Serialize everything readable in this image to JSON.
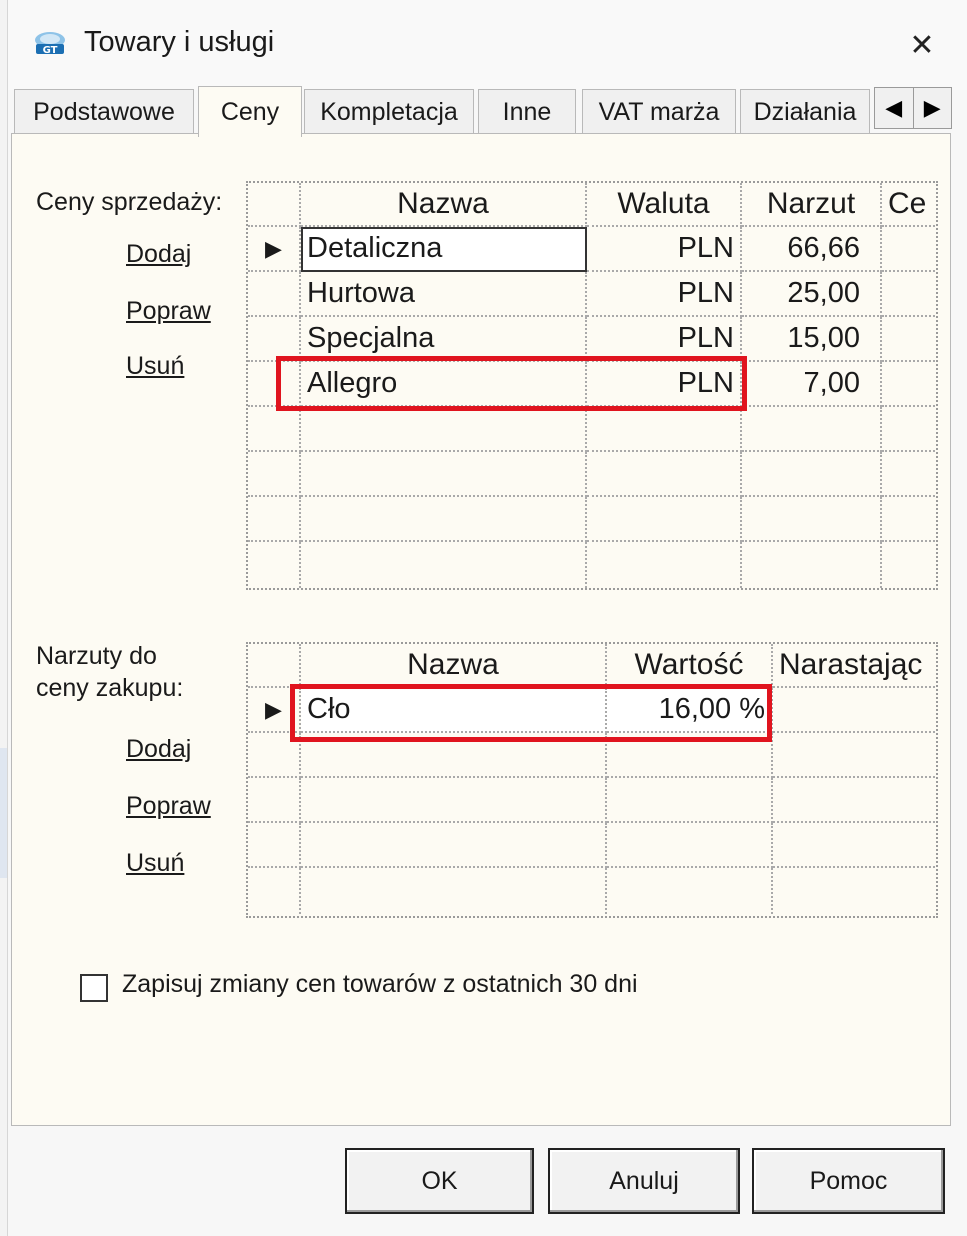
{
  "window": {
    "title": "Towary i usługi",
    "close_glyph": "✕",
    "logo_icon": "app-logo-icon"
  },
  "tabs": [
    {
      "label": "Podstawowe",
      "active": false
    },
    {
      "label": "Ceny",
      "active": true
    },
    {
      "label": "Kompletacja",
      "active": false
    },
    {
      "label": "Inne",
      "active": false
    },
    {
      "label": "VAT marża",
      "active": false
    },
    {
      "label": "Działania",
      "active": false
    }
  ],
  "tab_scroll": {
    "left": "◀",
    "right": "▶"
  },
  "sales_prices": {
    "label": "Ceny sprzedaży:",
    "links": {
      "add": "Dodaj",
      "edit": "Popraw",
      "delete": "Usuń"
    },
    "columns": [
      "Nazwa",
      "Waluta",
      "Narzut",
      "Ce"
    ],
    "rows": [
      {
        "indicator": "▶",
        "name": "Detaliczna",
        "currency": "PLN",
        "markup": "66,66",
        "price": ""
      },
      {
        "indicator": "",
        "name": "Hurtowa",
        "currency": "PLN",
        "markup": "25,00",
        "price": ""
      },
      {
        "indicator": "",
        "name": "Specjalna",
        "currency": "PLN",
        "markup": "15,00",
        "price": ""
      },
      {
        "indicator": "",
        "name": "Allegro",
        "currency": "PLN",
        "markup": "7,00",
        "price": ""
      }
    ]
  },
  "purchase_markups": {
    "label_line1": "Narzuty do",
    "label_line2": "ceny zakupu:",
    "links": {
      "add": "Dodaj",
      "edit": "Popraw",
      "delete": "Usuń"
    },
    "columns": [
      "Nazwa",
      "Wartość",
      "Narastając"
    ],
    "rows": [
      {
        "indicator": "▶",
        "name": "Cło",
        "value": "16,00 %",
        "cumulative": ""
      }
    ]
  },
  "checkbox": {
    "label": "Zapisuj zmiany cen towarów z ostatnich 30 dni",
    "checked": false
  },
  "buttons": {
    "ok": "OK",
    "cancel": "Anuluj",
    "help": "Pomoc"
  },
  "colors": {
    "highlight": "#e0141e",
    "panel_bg": "#fdfbf3"
  }
}
